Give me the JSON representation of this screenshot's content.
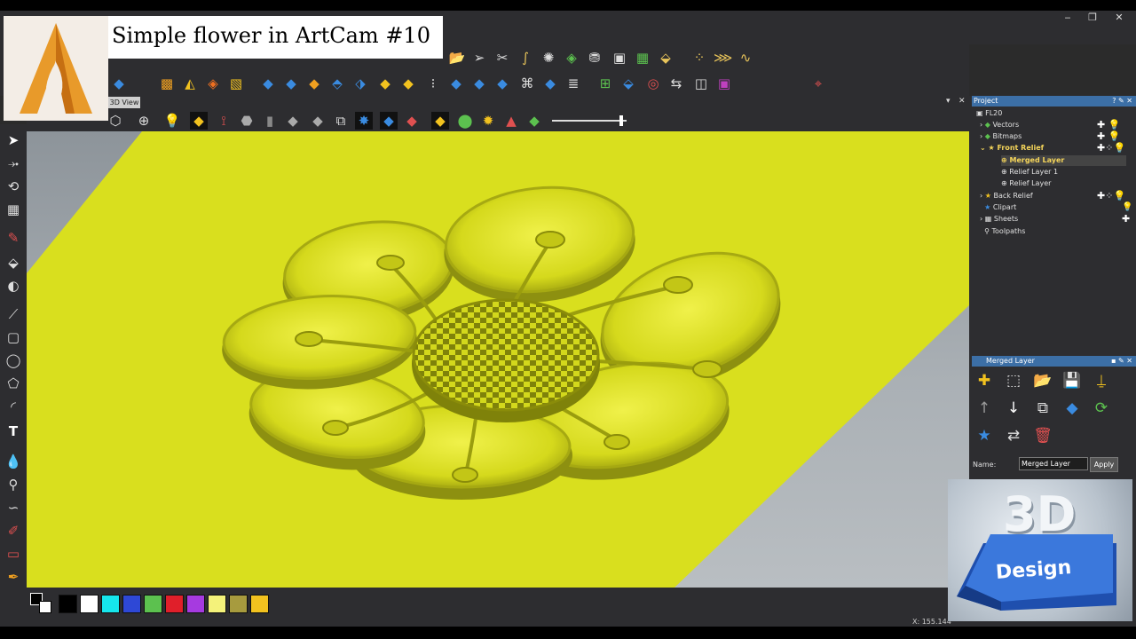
{
  "overlay": {
    "title": "Simple flower in ArtCam #10"
  },
  "window": {
    "minimize": "‒",
    "restore": "❐",
    "close": "✕"
  },
  "view": {
    "tab_label": "3D View",
    "pin": "▾",
    "close": "✕",
    "zoom_level": 0.9
  },
  "project": {
    "header": "Project",
    "header_controls": "? ✎ ✕",
    "root": "FL20",
    "items": [
      {
        "label": "Vectors"
      },
      {
        "label": "Bitmaps"
      },
      {
        "label": "Front Relief"
      },
      {
        "label": "Merged Layer"
      },
      {
        "label": "Relief Layer 1"
      },
      {
        "label": "Relief Layer"
      },
      {
        "label": "Back Relief"
      },
      {
        "label": "Clipart"
      },
      {
        "label": "Sheets"
      },
      {
        "label": "Toolpaths"
      }
    ]
  },
  "layer_panel": {
    "header": "Merged Layer",
    "header_controls": "▪ ✎ ✕",
    "name_label": "Name:",
    "name_value": "Merged Layer",
    "apply_label": "Apply"
  },
  "palette": {
    "colors": [
      "#000000",
      "#ffffff",
      "#16e6ec",
      "#2e48d6",
      "#5cc14f",
      "#e01f2a",
      "#a63ae0",
      "#f4f27a",
      "#a79b3e",
      "#f2c21f"
    ]
  },
  "status": {
    "coord": "X: 155.144"
  },
  "badge": {
    "line1": "3D",
    "line2": "Design"
  },
  "colors": {
    "relief": "#d9df1e",
    "accent": "#3c6fa6"
  }
}
